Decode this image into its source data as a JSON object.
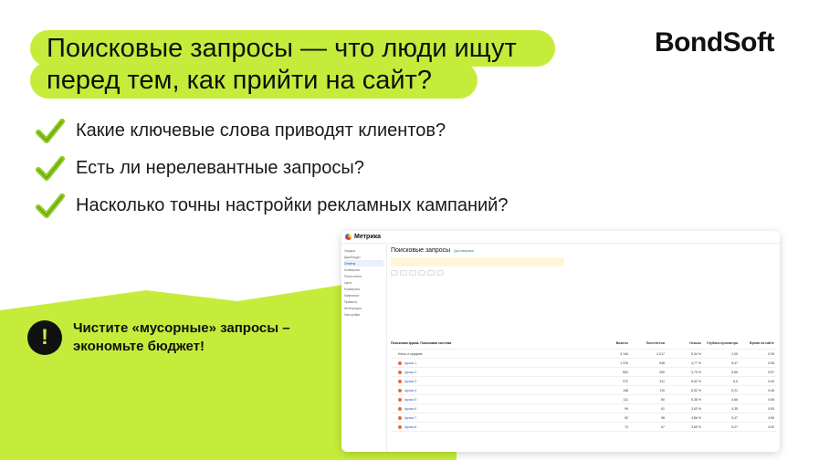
{
  "title": {
    "line1": "Поисковые запросы — что люди ищут",
    "line2": "перед тем, как прийти на сайт?"
  },
  "logo": "BondSoft",
  "bullets": [
    "Какие ключевые слова приводят клиентов?",
    "Есть ли нерелевантные запросы?",
    "Насколько точны настройки рекламных кампаний?"
  ],
  "tip": {
    "icon": "!",
    "text": "Чистите «мусорные» запросы – экономьте бюджет!"
  },
  "screenshot": {
    "app_name": "Метрика",
    "page_title": "Поисковые запросы",
    "verified": "Достоверные",
    "sidebar": [
      "Сводка",
      "Дашборды",
      "Отчёты",
      "Конверсии",
      "Посетители",
      "Цели",
      "Конверсии",
      "Кампании",
      "Правила",
      "Интеграции",
      "Настройки"
    ],
    "table_header": [
      "Поисковая фраза, Поисковая система",
      "Визиты",
      "Посетители",
      "Отказы",
      "Глубина просмотра",
      "Время на сайте"
    ],
    "rows": [
      {
        "label": "Итого и средние",
        "v": [
          "4 146",
          "4 017",
          "5,34 %",
          "2,05",
          "0:35"
        ]
      },
      {
        "label": "фраза 1",
        "v": [
          "1 376",
          "948",
          "4,77 %",
          "5,47",
          "0:46"
        ]
      },
      {
        "label": "фраза 2",
        "v": [
          "554",
          "390",
          "3,75 %",
          "5,56",
          "0:57"
        ]
      },
      {
        "label": "фраза 3",
        "v": [
          "372",
          "311",
          "6,52 %",
          "5,9",
          "0:49"
        ]
      },
      {
        "label": "фраза 4",
        "v": [
          "138",
          "115",
          "8,32 %",
          "5,21",
          "0:46"
        ]
      },
      {
        "label": "фраза 5",
        "v": [
          "111",
          "80",
          "5,38 %",
          "4,66",
          "0:58"
        ]
      },
      {
        "label": "фраза 6",
        "v": [
          "99",
          "61",
          "3,63 %",
          "4,35",
          "0:53"
        ]
      },
      {
        "label": "фраза 7",
        "v": [
          "92",
          "58",
          "4,86 %",
          "5,47",
          "4:05"
        ]
      },
      {
        "label": "фраза 8",
        "v": [
          "74",
          "67",
          "3,65 %",
          "5,27",
          "4:00"
        ]
      }
    ]
  }
}
